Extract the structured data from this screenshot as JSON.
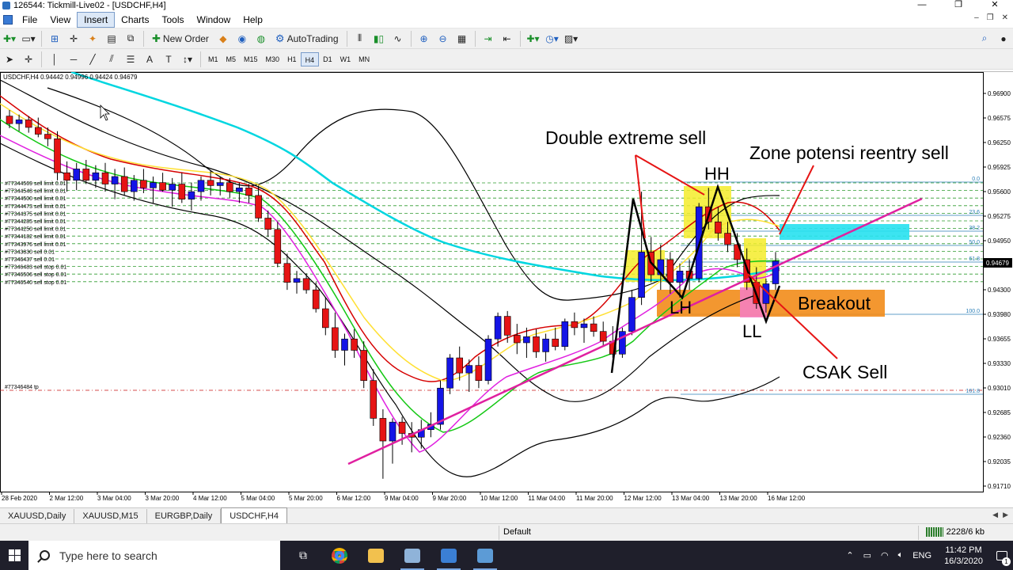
{
  "window": {
    "title": "126544: Tickmill-Live02 - [USDCHF,H4]",
    "controls": [
      "—",
      "❐",
      "✕"
    ],
    "mdi_controls": [
      "–",
      "❐",
      "✕"
    ]
  },
  "menu": {
    "items": [
      "File",
      "View",
      "Insert",
      "Charts",
      "Tools",
      "Window",
      "Help"
    ],
    "active": "Insert"
  },
  "toolbar": {
    "new_order": "New Order",
    "auto_trading": "AutoTrading"
  },
  "timeframes": {
    "items": [
      "M1",
      "M5",
      "M15",
      "M30",
      "H1",
      "H4",
      "D1",
      "W1",
      "MN"
    ],
    "active": "H4"
  },
  "chart": {
    "symbol_header": "USDCHF,H4  0.94442 0.94996 0.94424 0.94679",
    "current_price": "0.94679",
    "price_axis": {
      "labels": [
        "0.96900",
        "0.96575",
        "0.96250",
        "0.95925",
        "0.95600",
        "0.95275",
        "0.94950",
        "0.94625",
        "0.94300",
        "0.93980",
        "0.93655",
        "0.93330",
        "0.93010",
        "0.92685",
        "0.92360",
        "0.92035",
        "0.91710"
      ],
      "top": 0.969,
      "step": 0.003248
    },
    "time_axis": [
      "28 Feb 2020",
      "2 Mar 12:00",
      "3 Mar 04:00",
      "3 Mar 20:00",
      "4 Mar 12:00",
      "5 Mar 04:00",
      "5 Mar 20:00",
      "6 Mar 12:00",
      "9 Mar 04:00",
      "9 Mar 20:00",
      "10 Mar 12:00",
      "11 Mar 04:00",
      "11 Mar 20:00",
      "12 Mar 12:00",
      "13 Mar 04:00",
      "13 Mar 20:00",
      "16 Mar 12:00"
    ],
    "orders": [
      "#77344569 sell limit 0.01",
      "#77344548 sell limit 0.01",
      "#77344500 sell limit 0.01",
      "#77344473 sell limit 0.01",
      "#77344375 sell limit 0.01",
      "#77344285 sell limit 0.01",
      "#77344250 sell limit 0.01",
      "#77344182 sell limit 0.01",
      "#77343976 sell limit 0.01",
      "#77343830 sell 0.01",
      "#77346437 sell 0.01",
      "#77346483 sell stop 0.01",
      "#77346506 sell stop 0.01",
      "#77346540 sell stop 0.01"
    ],
    "tp_label": "#77346484 tp",
    "fib_levels": [
      "0.0",
      "23.6",
      "38.2",
      "50.0",
      "61.8",
      "100.0",
      "161.8"
    ],
    "annotations": {
      "double_extreme": "Double extreme sell",
      "zone": "Zone potensi reentry sell",
      "hh": "HH",
      "lh": "LH",
      "ll": "LL",
      "breakout": "Breakout",
      "csak": "CSAK Sell"
    },
    "candles": [
      [
        0.966,
        0.9668,
        0.9644,
        0.965
      ],
      [
        0.965,
        0.9662,
        0.964,
        0.9655
      ],
      [
        0.9655,
        0.966,
        0.9638,
        0.9645
      ],
      [
        0.9645,
        0.9658,
        0.9632,
        0.9636
      ],
      [
        0.9636,
        0.9645,
        0.962,
        0.963
      ],
      [
        0.963,
        0.964,
        0.9575,
        0.9585
      ],
      [
        0.9585,
        0.96,
        0.956,
        0.9575
      ],
      [
        0.9575,
        0.9598,
        0.9562,
        0.959
      ],
      [
        0.959,
        0.9602,
        0.957,
        0.9575
      ],
      [
        0.9575,
        0.9595,
        0.9565,
        0.9585
      ],
      [
        0.9585,
        0.9598,
        0.956,
        0.957
      ],
      [
        0.957,
        0.959,
        0.955,
        0.958
      ],
      [
        0.958,
        0.9592,
        0.9555,
        0.956
      ],
      [
        0.956,
        0.9582,
        0.9548,
        0.9575
      ],
      [
        0.9575,
        0.959,
        0.9558,
        0.9565
      ],
      [
        0.9565,
        0.958,
        0.9545,
        0.9572
      ],
      [
        0.9572,
        0.9585,
        0.956,
        0.9562
      ],
      [
        0.9562,
        0.9578,
        0.954,
        0.957
      ],
      [
        0.957,
        0.9585,
        0.9545,
        0.955
      ],
      [
        0.955,
        0.9572,
        0.9535,
        0.956
      ],
      [
        0.956,
        0.958,
        0.9548,
        0.9575
      ],
      [
        0.9575,
        0.9588,
        0.9555,
        0.9568
      ],
      [
        0.9568,
        0.958,
        0.9555,
        0.9572
      ],
      [
        0.9572,
        0.9578,
        0.9552,
        0.956
      ],
      [
        0.956,
        0.9572,
        0.9545,
        0.9565
      ],
      [
        0.9565,
        0.957,
        0.9545,
        0.9555
      ],
      [
        0.9555,
        0.9568,
        0.952,
        0.9525
      ],
      [
        0.9525,
        0.9535,
        0.95,
        0.951
      ],
      [
        0.951,
        0.952,
        0.946,
        0.9465
      ],
      [
        0.9465,
        0.9478,
        0.943,
        0.944
      ],
      [
        0.944,
        0.9455,
        0.9425,
        0.9445
      ],
      [
        0.9445,
        0.9452,
        0.9425,
        0.943
      ],
      [
        0.943,
        0.944,
        0.94,
        0.9405
      ],
      [
        0.9405,
        0.942,
        0.937,
        0.938
      ],
      [
        0.938,
        0.94,
        0.934,
        0.935
      ],
      [
        0.935,
        0.9372,
        0.933,
        0.9365
      ],
      [
        0.9365,
        0.9378,
        0.934,
        0.935
      ],
      [
        0.935,
        0.9362,
        0.93,
        0.931
      ],
      [
        0.931,
        0.9325,
        0.925,
        0.926
      ],
      [
        0.926,
        0.9272,
        0.918,
        0.923
      ],
      [
        0.923,
        0.926,
        0.92,
        0.9255
      ],
      [
        0.9255,
        0.9262,
        0.9225,
        0.924
      ],
      [
        0.924,
        0.9255,
        0.9215,
        0.9235
      ],
      [
        0.9235,
        0.9258,
        0.922,
        0.9245
      ],
      [
        0.9245,
        0.9268,
        0.9235,
        0.9252
      ],
      [
        0.9252,
        0.931,
        0.9245,
        0.93
      ],
      [
        0.93,
        0.9345,
        0.9292,
        0.934
      ],
      [
        0.934,
        0.9355,
        0.931,
        0.932
      ],
      [
        0.932,
        0.9338,
        0.9295,
        0.933
      ],
      [
        0.933,
        0.9342,
        0.93,
        0.931
      ],
      [
        0.931,
        0.937,
        0.9305,
        0.9365
      ],
      [
        0.9365,
        0.94,
        0.9355,
        0.9395
      ],
      [
        0.9395,
        0.9402,
        0.936,
        0.937
      ],
      [
        0.937,
        0.9385,
        0.9345,
        0.936
      ],
      [
        0.936,
        0.938,
        0.934,
        0.9368
      ],
      [
        0.9368,
        0.9378,
        0.934,
        0.9348
      ],
      [
        0.9348,
        0.9372,
        0.9335,
        0.9365
      ],
      [
        0.9365,
        0.938,
        0.935,
        0.9355
      ],
      [
        0.9355,
        0.9392,
        0.935,
        0.9388
      ],
      [
        0.9388,
        0.94,
        0.937,
        0.938
      ],
      [
        0.938,
        0.9392,
        0.936,
        0.9385
      ],
      [
        0.9385,
        0.9395,
        0.9368,
        0.9375
      ],
      [
        0.9375,
        0.9388,
        0.9355,
        0.9362
      ],
      [
        0.9362,
        0.9382,
        0.934,
        0.9345
      ],
      [
        0.9345,
        0.938,
        0.934,
        0.9375
      ],
      [
        0.9375,
        0.943,
        0.937,
        0.942
      ],
      [
        0.942,
        0.956,
        0.941,
        0.948
      ],
      [
        0.948,
        0.95,
        0.944,
        0.945
      ],
      [
        0.945,
        0.949,
        0.943,
        0.947
      ],
      [
        0.947,
        0.948,
        0.9425,
        0.944
      ],
      [
        0.944,
        0.9465,
        0.942,
        0.9455
      ],
      [
        0.9455,
        0.947,
        0.943,
        0.9445
      ],
      [
        0.9445,
        0.9545,
        0.944,
        0.954
      ],
      [
        0.954,
        0.9565,
        0.951,
        0.952
      ],
      [
        0.952,
        0.954,
        0.9495,
        0.9505
      ],
      [
        0.9505,
        0.952,
        0.948,
        0.949
      ],
      [
        0.949,
        0.9505,
        0.946,
        0.947
      ],
      [
        0.947,
        0.9485,
        0.943,
        0.944
      ],
      [
        0.944,
        0.946,
        0.9405,
        0.9412
      ],
      [
        0.9412,
        0.9445,
        0.94,
        0.9438
      ],
      [
        0.9438,
        0.948,
        0.943,
        0.9468
      ]
    ],
    "ma_colors": [
      "#000000",
      "#00d6e0",
      "#d60000",
      "#ffe033",
      "#14c814",
      "#e020e0"
    ]
  },
  "tabs": {
    "items": [
      "XAUUSD,Daily",
      "XAUUSD,M15",
      "EURGBP,Daily",
      "USDCHF,H4"
    ],
    "active": "USDCHF,H4"
  },
  "status": {
    "profile": "Default",
    "traffic": "2228/6 kb"
  },
  "taskbar": {
    "search_placeholder": "Type here to search",
    "language": "ENG",
    "time": "11:42 PM",
    "date": "16/3/2020",
    "notifications": "1"
  }
}
